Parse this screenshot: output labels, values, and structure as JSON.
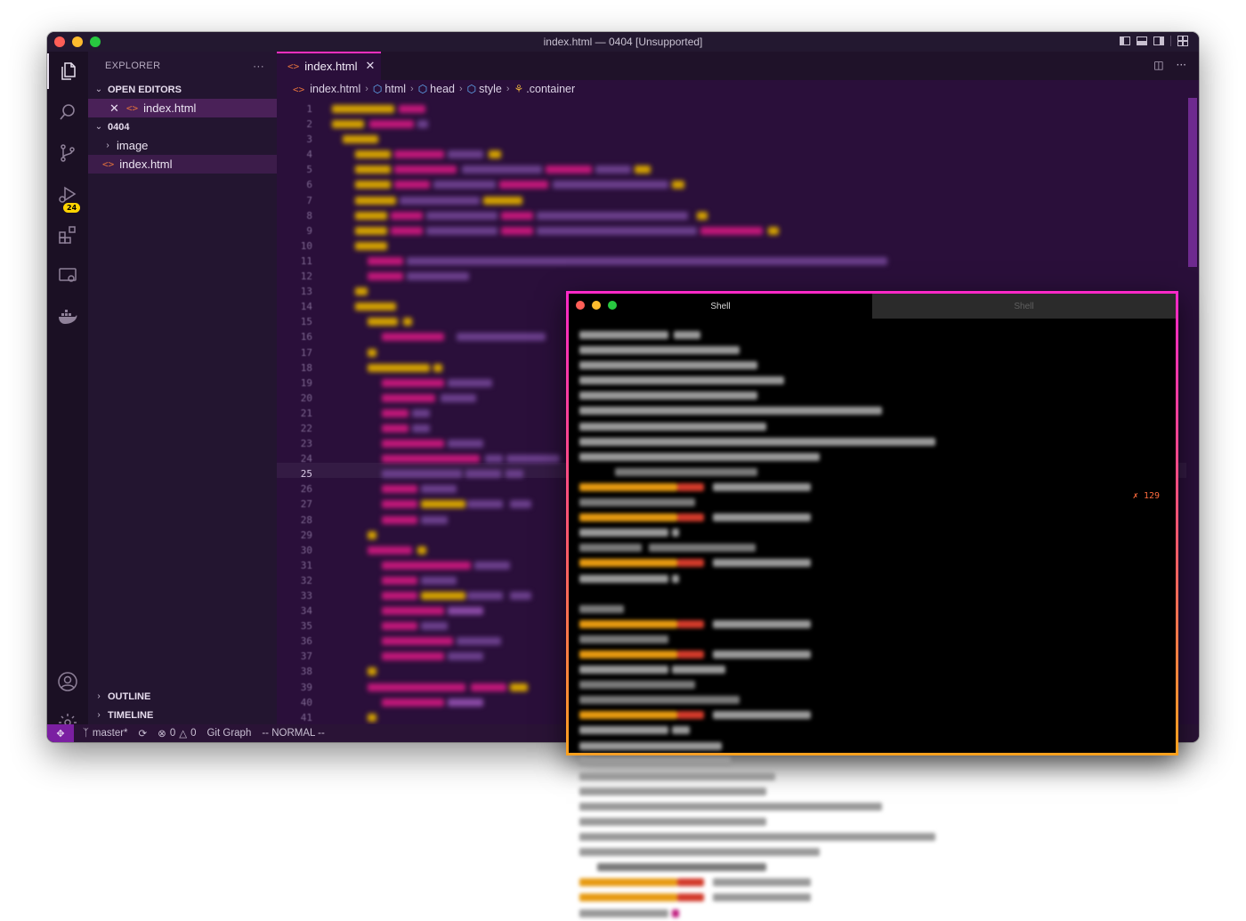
{
  "window": {
    "title": "index.html — 0404 [Unsupported]"
  },
  "activity_bar": {
    "scm_badge": "24"
  },
  "sidebar": {
    "header": "EXPLORER",
    "more": "···",
    "open_editors_label": "OPEN EDITORS",
    "open_editor_file": "index.html",
    "folder_label": "0404",
    "folder_items": [
      {
        "type": "folder",
        "label": "image"
      },
      {
        "type": "file",
        "label": "index.html"
      }
    ],
    "outline_label": "OUTLINE",
    "timeline_label": "TIMELINE"
  },
  "editor": {
    "tab_label": "index.html",
    "breadcrumb": [
      "index.html",
      "html",
      "head",
      "style",
      ".container"
    ],
    "line_numbers": [
      "1",
      "2",
      "3",
      "4",
      "5",
      "6",
      "7",
      "8",
      "9",
      "10",
      "11",
      "12",
      "13",
      "14",
      "15",
      "16",
      "17",
      "18",
      "19",
      "20",
      "21",
      "22",
      "23",
      "24",
      "25",
      "26",
      "27",
      "28",
      "29",
      "30",
      "31",
      "32",
      "33",
      "34",
      "35",
      "36",
      "37",
      "38",
      "39",
      "40",
      "41"
    ],
    "current_line": "25"
  },
  "statusbar": {
    "branch": "master*",
    "errors": "0",
    "warnings": "0",
    "git_graph": "Git Graph",
    "vim_mode": "-- NORMAL --"
  },
  "shell": {
    "tabs": [
      "Shell",
      "Shell"
    ],
    "error_count": "129"
  },
  "colors": {
    "accent_pink": "#ff2fbf",
    "accent_orange": "#ffa11e",
    "editor_bg": "#2a0f3a",
    "sidebar_bg": "#231530",
    "badge": "#ffd400"
  }
}
